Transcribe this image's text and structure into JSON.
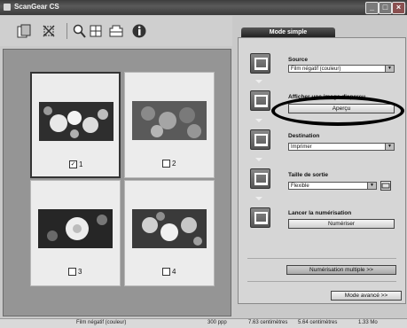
{
  "window": {
    "title": "ScanGear CS",
    "controls": [
      "minimize",
      "maximize",
      "close"
    ]
  },
  "toolbar": {
    "icons": [
      "multi-page-icon",
      "crop-icon",
      "zoom-icon",
      "copy-frames-icon",
      "frames-icon",
      "info-icon"
    ]
  },
  "preview": {
    "frames": [
      {
        "label": "1",
        "checked": true
      },
      {
        "label": "2",
        "checked": false
      },
      {
        "label": "3",
        "checked": false
      },
      {
        "label": "4",
        "checked": false
      }
    ]
  },
  "mode_tab": {
    "label": "Mode simple"
  },
  "steps": {
    "source": {
      "label": "Source",
      "value": "Film négatif (couleur)"
    },
    "preview": {
      "label": "Afficher une image d'aperçu",
      "button": "Aperçu"
    },
    "destination": {
      "label": "Destination",
      "value": "Imprimer"
    },
    "output_size": {
      "label": "Taille de sortie",
      "value": "Flexible"
    },
    "scan": {
      "label": "Lancer la numérisation",
      "button": "Numériser"
    }
  },
  "multi_scan_button": "Numérisation multiple >>",
  "advanced_mode_button": "Mode avancé >>",
  "status": {
    "film": "Film négatif (couleur)",
    "resolution": "300 ppp",
    "dimension1": "7.63 centimètres",
    "dimension2": "5.64 centimètres",
    "size": "1.33 Mo"
  },
  "colors": {
    "title_bar": "#3d3d3d",
    "background": "#c9c9c9",
    "preview_bg": "#959595"
  }
}
